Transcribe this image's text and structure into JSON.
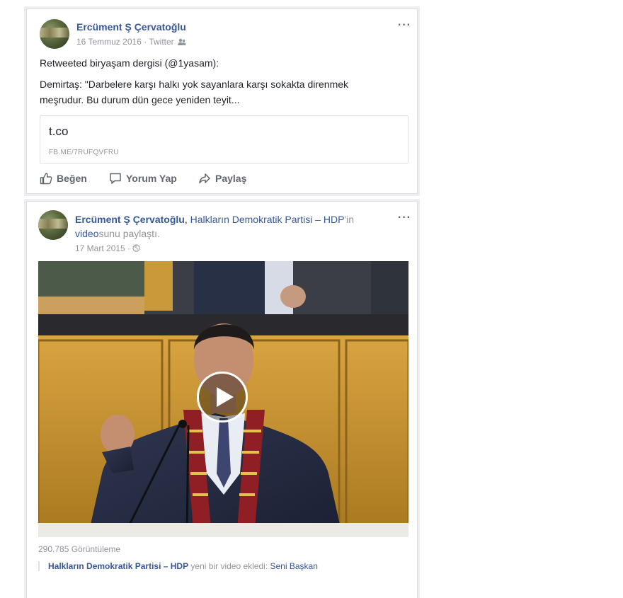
{
  "post1": {
    "author": "Ercüment Ş Çervatoğlu",
    "date": "16 Temmuz 2016",
    "source": "Twitter",
    "sep": "·",
    "more": "···",
    "retweet_line": "Retweeted biryaşam dergisi (@1yasam):",
    "body_line1": "Demirtaş: \"Darbelere karşı halkı yok sayanlara karşı sokakta direnmek",
    "body_line2": "meşrudur. Bu durum dün gece yeniden teyit...",
    "link_title": "t.co",
    "link_url": "FB.ME/7RUFQVFRU",
    "actions": {
      "like": "Beğen",
      "comment": "Yorum Yap",
      "share": "Paylaş"
    }
  },
  "post2": {
    "author": "Ercüment Ş Çervatoğlu",
    "header_mid": ", ",
    "page_name": "Halkların Demokratik Partisi – HDP",
    "header_suffix": "'in",
    "video_word": "video",
    "header_tail": "sunu paylaştı.",
    "date": "17 Mart 2015",
    "sep": "·",
    "more": "···",
    "views": "290.785 Görüntüleme",
    "shared_page": "Halkların Demokratik Partisi – HDP",
    "shared_text": " yeni bir video ekledi: ",
    "shared_title": "Seni Başkan"
  },
  "icons": {
    "globe": "globe-icon",
    "friends": "friends-icon",
    "play": "play-icon"
  }
}
